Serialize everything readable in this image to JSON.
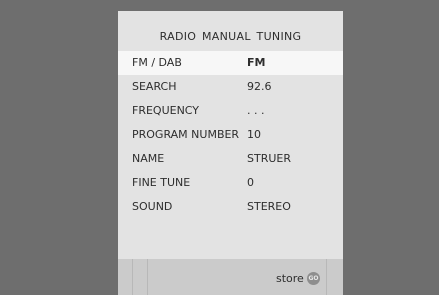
{
  "panel": {
    "title": "RADIO MANUAL TUNING"
  },
  "rows": [
    {
      "label": "FM / DAB",
      "value": "FM"
    },
    {
      "label": "SEARCH",
      "value": "92.6"
    },
    {
      "label": "FREQUENCY",
      "value": ". . ."
    },
    {
      "label": "PROGRAM NUMBER",
      "value": "10"
    },
    {
      "label": "NAME",
      "value": "STRUER"
    },
    {
      "label": "FINE TUNE",
      "value": "0"
    },
    {
      "label": "SOUND",
      "value": "STEREO"
    }
  ],
  "footer": {
    "store_label": "store",
    "go_icon_text": "GO"
  },
  "colors": {
    "background": "#6e6e6e",
    "panel": "#e3e3e3",
    "selected_row": "#f7f7f7",
    "footer": "#cbcbcb"
  }
}
